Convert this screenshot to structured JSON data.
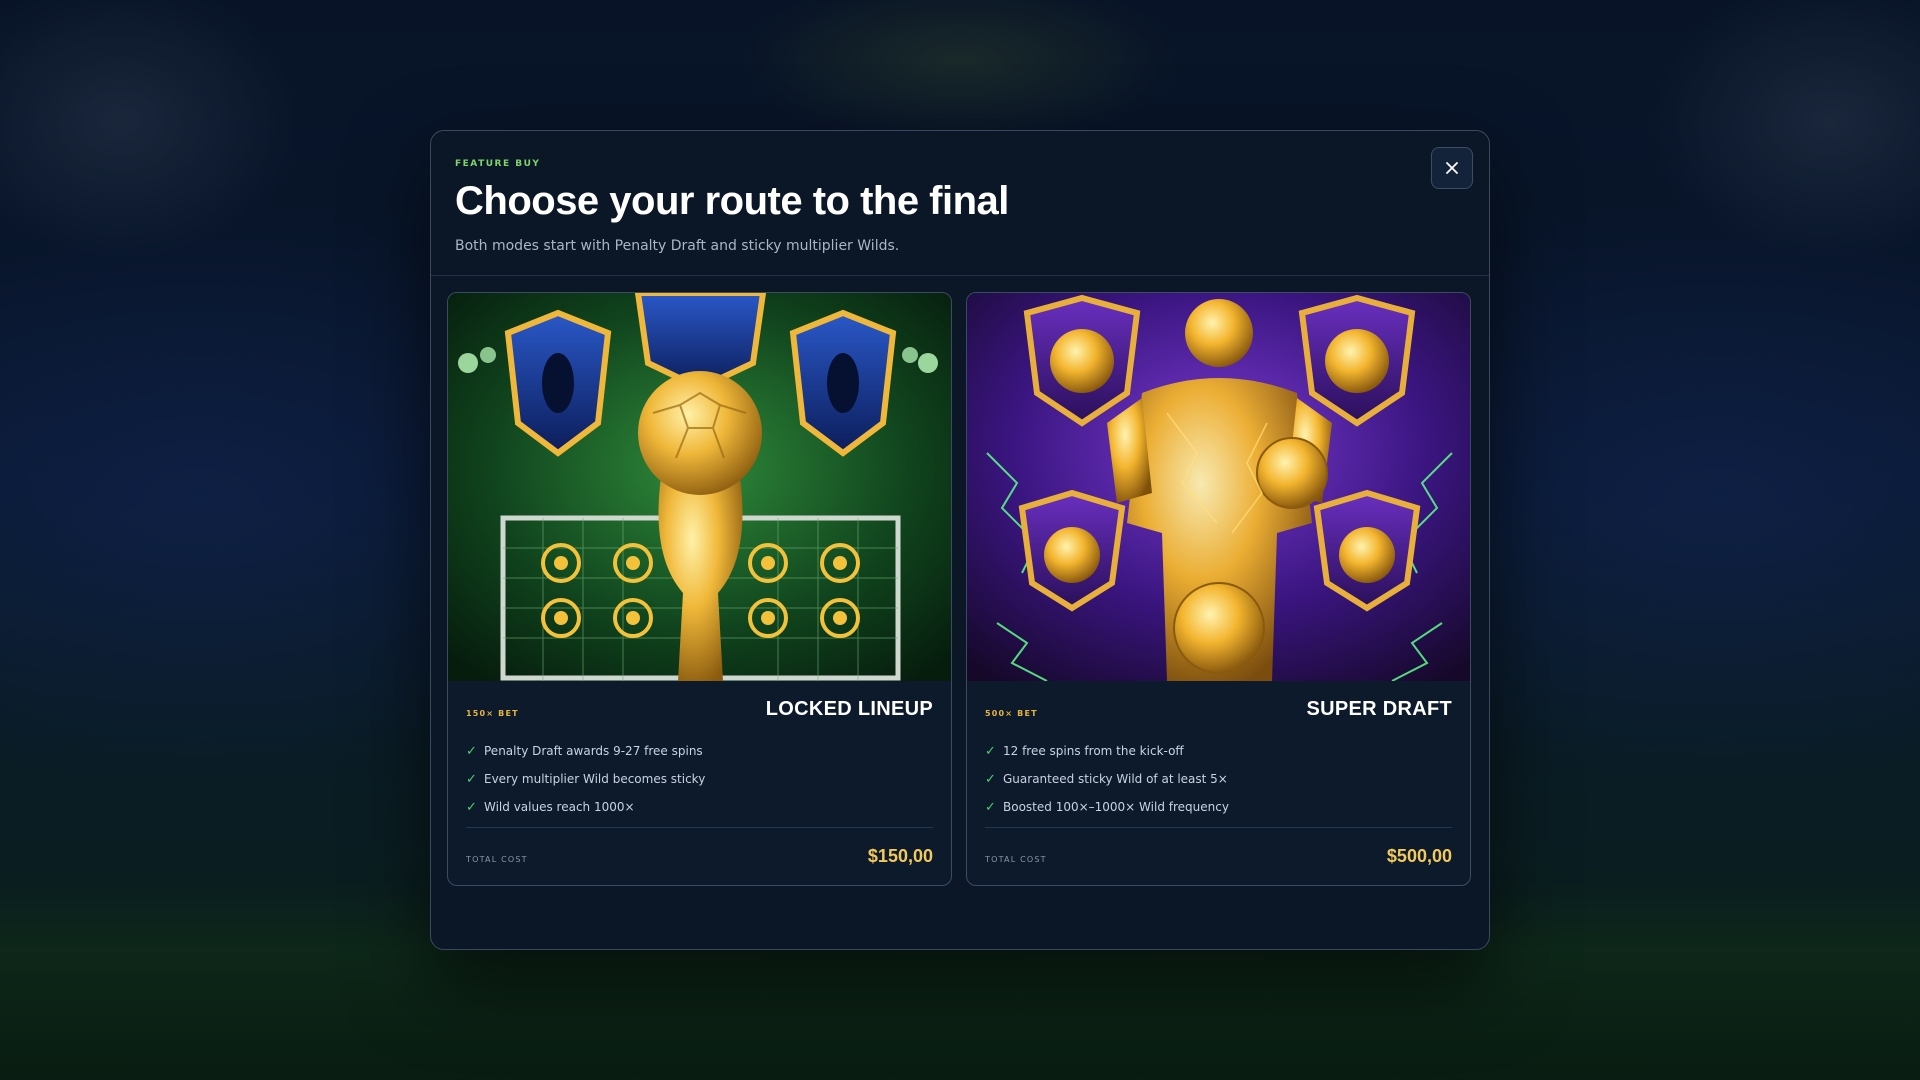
{
  "header": {
    "eyebrow": "FEATURE BUY",
    "title": "Choose your route to the final",
    "subtitle": "Both modes start with Penalty Draft and sticky multiplier Wilds.",
    "close_icon": "close-icon"
  },
  "cards": [
    {
      "bet_tag": "150× BET",
      "name": "LOCKED LINEUP",
      "features": [
        "Penalty Draft awards 9-27 free spins",
        "Every multiplier Wild becomes sticky",
        "Wild values reach 1000×"
      ],
      "cost_label": "TOTAL COST",
      "cost_value": "$150,00"
    },
    {
      "bet_tag": "500× BET",
      "name": "SUPER DRAFT",
      "features": [
        "12 free spins from the kick-off",
        "Guaranteed sticky Wild of at least 5×",
        "Boosted 100×–1000× Wild frequency"
      ],
      "cost_label": "TOTAL COST",
      "cost_value": "$500,00"
    }
  ],
  "colors": {
    "accent_green": "#7fd36a",
    "accent_gold": "#f3c95a",
    "check_green": "#4fd06b",
    "modal_bg": "#0b1726"
  }
}
